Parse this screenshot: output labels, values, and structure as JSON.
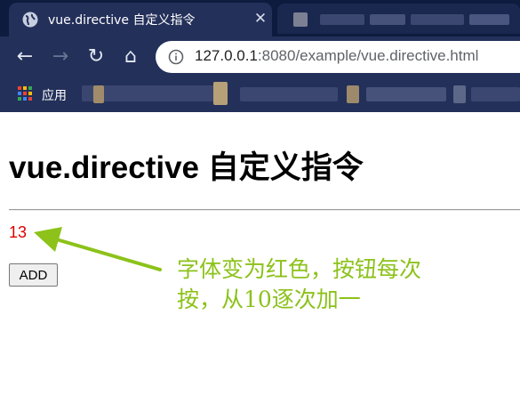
{
  "browser": {
    "tab": {
      "title": "vue.directive 自定义指令",
      "close_glyph": "✕",
      "favicon": "globe-icon"
    },
    "nav": {
      "back_glyph": "←",
      "forward_glyph": "→",
      "reload_glyph": "↻",
      "home_glyph": "⌂"
    },
    "address": {
      "host": "127.0.0.1",
      "path": ":8080/example/vue.directive.html"
    },
    "bookmarks": {
      "apps_label": "应用"
    }
  },
  "page": {
    "title": "vue.directive 自定义指令",
    "counter": "13",
    "counter_color": "#e00000",
    "add_label": "ADD"
  },
  "annotation": {
    "line1": "字体变为红色，按钮每次",
    "line2": "按，从10逐次加一",
    "color": "#8cc21a"
  },
  "colors": {
    "chrome_dark": "#0d1b3e",
    "chrome": "#23305a"
  }
}
